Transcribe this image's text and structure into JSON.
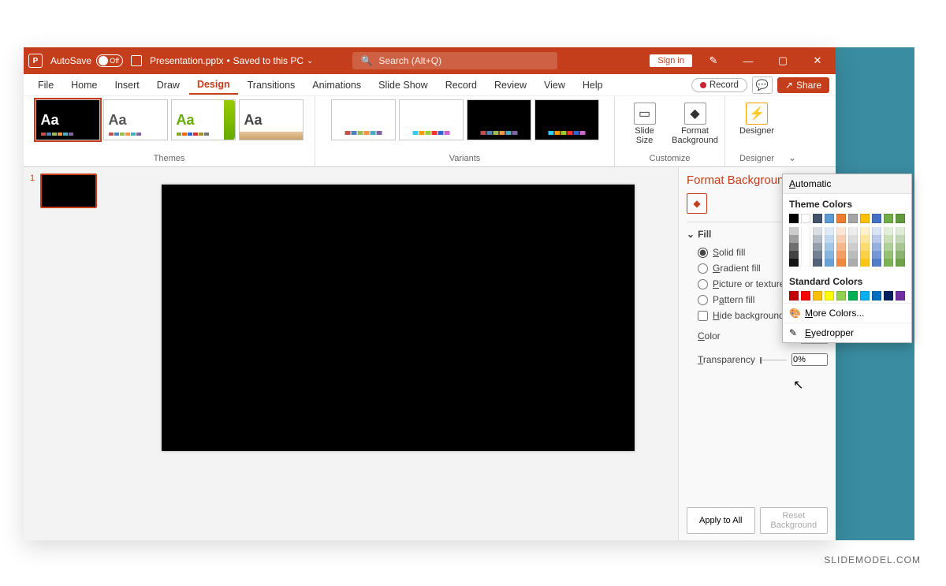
{
  "titlebar": {
    "autosave_label": "AutoSave",
    "autosave_state": "Off",
    "filename": "Presentation.pptx",
    "save_status": "Saved to this PC",
    "search_placeholder": "Search (Alt+Q)",
    "signin": "Sign in"
  },
  "menu": {
    "tabs": [
      "File",
      "Home",
      "Insert",
      "Draw",
      "Design",
      "Transitions",
      "Animations",
      "Slide Show",
      "Record",
      "Review",
      "View",
      "Help"
    ],
    "active": "Design",
    "record": "Record",
    "share": "Share"
  },
  "ribbon": {
    "themes_label": "Themes",
    "variants_label": "Variants",
    "customize_label": "Customize",
    "designer_label": "Designer",
    "slide_size": "Slide\nSize",
    "format_bg": "Format\nBackground",
    "designer_btn": "Designer"
  },
  "thumb": {
    "num": "1"
  },
  "pane": {
    "title": "Format Background",
    "fill_section": "Fill",
    "fill_options": {
      "solid": "Solid fill",
      "gradient": "Gradient fill",
      "picture": "Picture or texture fill",
      "pattern": "Pattern fill"
    },
    "hide_graphics": "Hide background graphics",
    "color_label": "Color",
    "transparency_label": "Transparency",
    "transparency_value": "0%",
    "apply_all": "Apply to All",
    "reset": "Reset Background"
  },
  "colorpicker": {
    "automatic": "Automatic",
    "theme_colors": "Theme Colors",
    "standard_colors": "Standard Colors",
    "more_colors": "More Colors...",
    "eyedropper": "Eyedropper",
    "theme_row": [
      "#000000",
      "#ffffff",
      "#44546a",
      "#5b9bd5",
      "#ed7d31",
      "#a5a5a5",
      "#ffc000",
      "#4472c4",
      "#70ad47",
      "#62993e"
    ],
    "standard_row": [
      "#c00000",
      "#ff0000",
      "#ffc000",
      "#ffff00",
      "#92d050",
      "#00b050",
      "#00b0f0",
      "#0070c0",
      "#002060",
      "#7030a0"
    ]
  },
  "watermark": "SLIDEMODEL.COM"
}
